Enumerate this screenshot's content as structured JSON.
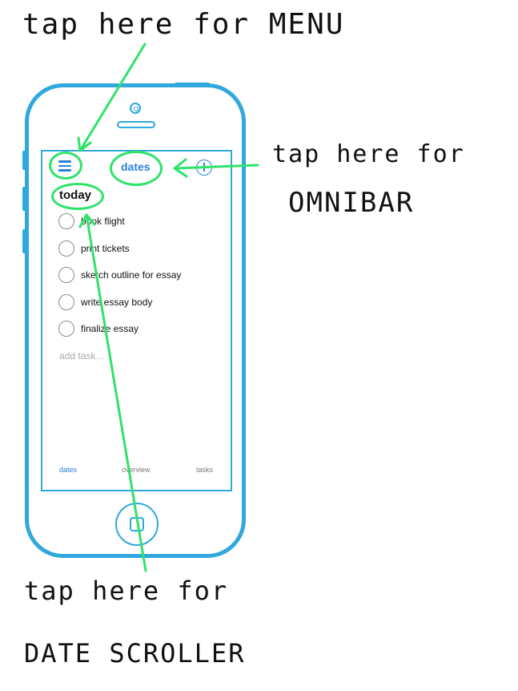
{
  "annotations": {
    "menu": "tap here for MENU",
    "omnibar_line1": "tap here for",
    "omnibar_line2": "OMNIBAR",
    "date_line1": "tap here for",
    "date_line2": "DATE SCROLLER"
  },
  "app": {
    "header": {
      "menu_icon": "hamburger-menu-icon",
      "title": "dates",
      "add_icon": "plus-circle-icon"
    },
    "section_title": "today",
    "tasks": [
      {
        "label": "book flight"
      },
      {
        "label": "print tickets"
      },
      {
        "label": "sketch outline for essay"
      },
      {
        "label": "write essay body"
      },
      {
        "label": "finalize essay"
      }
    ],
    "add_task_placeholder": "add task...",
    "tabs": [
      {
        "label": "dates",
        "active": true
      },
      {
        "label": "overview",
        "active": false
      },
      {
        "label": "tasks",
        "active": false
      }
    ]
  },
  "colors": {
    "phone_outline": "#30a8dd",
    "accent": "#2a82d8",
    "annotation_green": "#2fe36a"
  }
}
